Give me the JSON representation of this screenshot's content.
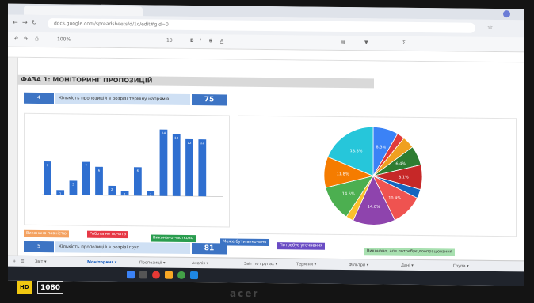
{
  "browser": {
    "url": "docs.google.com/spreadsheets/d/1c/edit#gid=0"
  },
  "toolbar": {
    "zoom": "100%",
    "font_size": "10"
  },
  "sheet": {
    "title": "ФАЗА 1: МОНІТОРИНГ ПРОПОЗИЦІЙ",
    "kpi_top": {
      "label": "Кількість пропозицій в розрізі терміну напрямів",
      "value": "75"
    },
    "kpi_bottom": {
      "label": "Кількість пропозицій в розрізі груп",
      "value": "81"
    },
    "status_chips": [
      {
        "label": "Виконано повністю",
        "color": "#f4a261"
      },
      {
        "label": "Робота не почата",
        "color": "#e63946"
      },
      {
        "label": "Виконано частково",
        "color": "#2a9d4f"
      },
      {
        "label": "Може бути виконано",
        "color": "#3d74c4"
      },
      {
        "label": "Потребує уточнення",
        "color": "#6a4cc4"
      },
      {
        "label": "Виконано, але потребує доопрацювання",
        "color": "#a8e0b0"
      }
    ]
  },
  "chart_data": [
    {
      "type": "bar",
      "categories": [
        "",
        "",
        "",
        "",
        "",
        "",
        "",
        "",
        "",
        "",
        "",
        "",
        "",
        ""
      ],
      "values": [
        7,
        1,
        3,
        7,
        6,
        2,
        1,
        6,
        1,
        14,
        13,
        12,
        12,
        0
      ],
      "ylim": [
        0,
        15
      ],
      "color": "#2f6fd0"
    },
    {
      "type": "pie",
      "values": [
        8.3,
        2.5,
        4.0,
        6.4,
        8.1,
        3.0,
        10.4,
        14.0,
        2.5,
        11.8,
        10.2,
        18.8
      ],
      "colors": [
        "#3b82f6",
        "#e03a3a",
        "#f0a020",
        "#2e7d32",
        "#c62828",
        "#1565c0",
        "#ef5350",
        "#8e44ad",
        "#fbc02d",
        "#4caf50",
        "#f57c00",
        "#26c6da"
      ],
      "slice_labels": [
        "8.3%",
        "",
        "",
        "6.4%",
        "8.1%",
        "",
        "10.4%",
        "14.0%",
        "",
        "14.5%",
        "11.8%",
        "18.8%"
      ]
    }
  ],
  "sheet_tabs": [
    "Звіт",
    "Моніторинг",
    "Пропозиції",
    "Аналіз",
    "Звіт по групах",
    "Терміни",
    "Фільтри",
    "Дані",
    "Група"
  ],
  "device": {
    "badge_hd": "HD",
    "badge_res": "1080",
    "brand": "acer"
  }
}
